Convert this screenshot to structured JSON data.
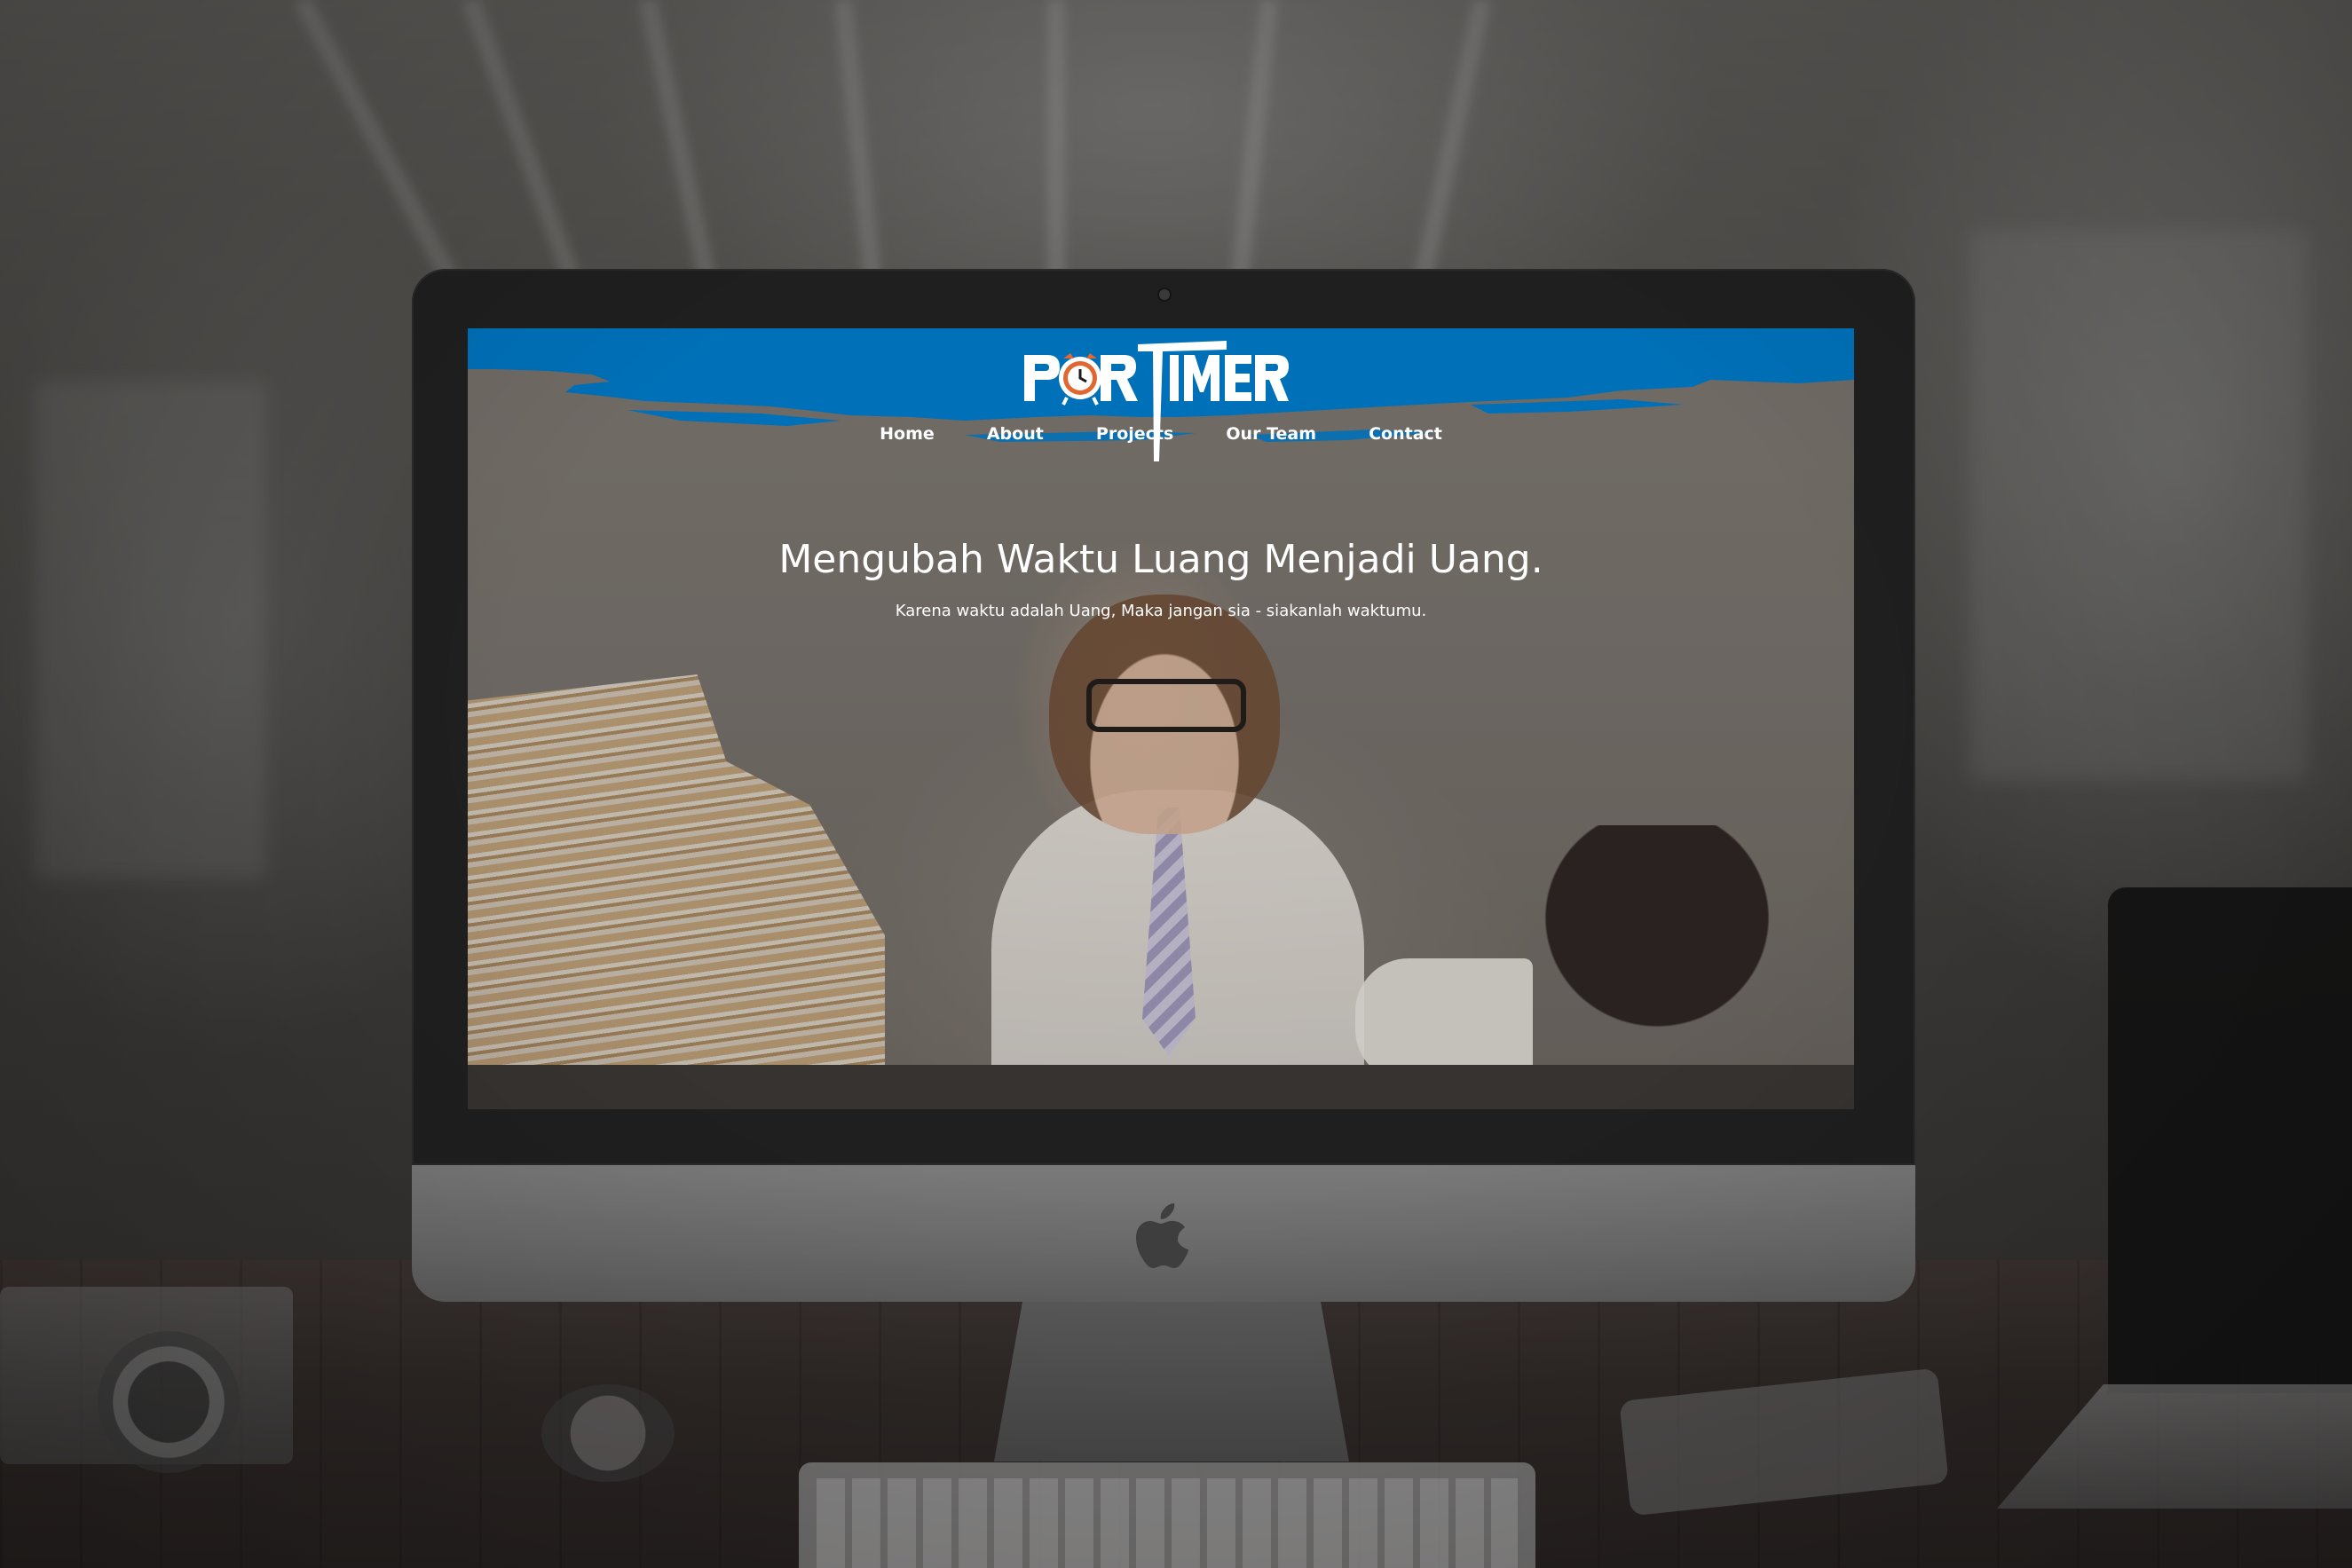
{
  "website": {
    "logo_text": "PARTIMER",
    "nav": {
      "items": [
        {
          "label": "Home"
        },
        {
          "label": "About"
        },
        {
          "label": "Projects"
        },
        {
          "label": "Our Team"
        },
        {
          "label": "Contact"
        }
      ]
    },
    "hero": {
      "title": "Mengubah Waktu Luang Menjadi Uang.",
      "subtitle": "Karena waktu adalah Uang, Maka jangan sia - siakanlah waktumu."
    }
  },
  "colors": {
    "header_blue": "#0070b8",
    "logo_white": "#ffffff",
    "clock_orange": "#e2662f",
    "bezel": "#1f1f1f",
    "chin_silver": "#6b6b6b"
  },
  "icons": {
    "logo_clock": "alarm-clock-icon",
    "device_brand": "apple-logo-icon"
  }
}
